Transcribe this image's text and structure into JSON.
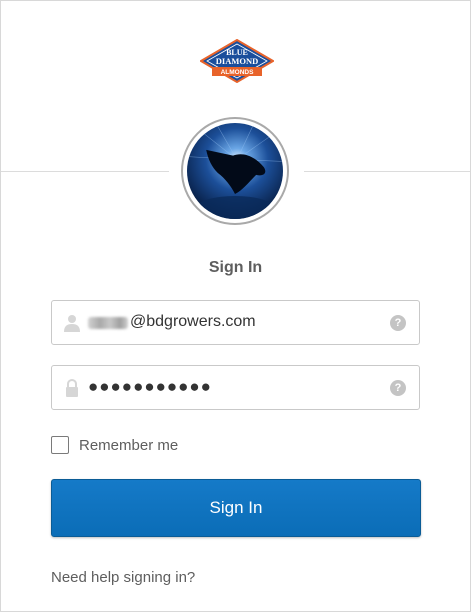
{
  "logo": {
    "line1": "BLUE",
    "line2": "DIAMOND",
    "line3": "ALMONDS"
  },
  "title": "Sign In",
  "username": {
    "value": "@bdgrowers.com",
    "help": "?"
  },
  "password": {
    "value": "●●●●●●●●●●●",
    "help": "?"
  },
  "remember_label": "Remember me",
  "submit_label": "Sign In",
  "help_link": "Need help signing in?",
  "colors": {
    "primary_button": "#0b6db7",
    "text": "#5e5e5e",
    "border": "#c9c9c9"
  }
}
